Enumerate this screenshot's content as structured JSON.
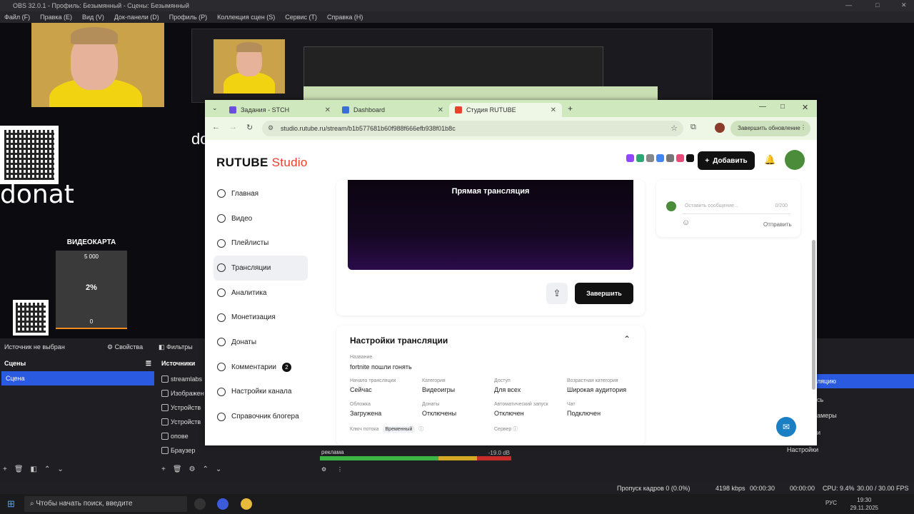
{
  "obs": {
    "window_title": "OBS 32.0.1 - Профиль: Безымянный - Сцены: Безымянный",
    "menu": [
      "Файл (F)",
      "Правка (E)",
      "Вид (V)",
      "Док-панели (D)",
      "Профиль (P)",
      "Коллекция сцен (S)",
      "Сервис (T)",
      "Справка (H)"
    ],
    "preview": {
      "donat_text": "donat",
      "do_fragment": "do",
      "gpu": {
        "title": "ВИДЕОКАРТА",
        "max": "5 000",
        "percent": "2%",
        "min": "0",
        "level_fraction": 0.02
      }
    },
    "source_status": "Источник не выбран",
    "properties_label": "Свойства",
    "filters_label": "Фильтры",
    "scenes_title": "Сцены",
    "scene_item": "Сцена",
    "sources_title": "Источники",
    "sources": [
      "streamlabs",
      "Изображен",
      "Устройств",
      "Устройств",
      "опове",
      "Браузер"
    ],
    "audio": {
      "name": "реклама",
      "db": "-19.0 dB"
    },
    "right_dock": [
      "ляцию",
      "сь",
      "амеры",
      "и",
      "Настройки"
    ],
    "status": {
      "dropped": "Пропуск кадров 0 (0.0%)",
      "bitrate": "4198 kbps",
      "live_time": "00:00:30",
      "rec_time": "00:00:00",
      "cpu": "CPU: 9.4%",
      "fps": "30.00 / 30.00 FPS"
    },
    "taskbar": {
      "search_placeholder": "Чтобы начать поиск, введите",
      "lang": "РУС",
      "time": "19:30",
      "date": "29.11.2025"
    }
  },
  "browser": {
    "tabs": [
      {
        "label": "Задания - STCH",
        "color": "#6b4fd8"
      },
      {
        "label": "Dashboard",
        "color": "#3a6fd8"
      },
      {
        "label": "Студия RUTUBE",
        "color": "#e8422f"
      }
    ],
    "url": "studio.rutube.ru/stream/b1b577681b60f988f666efb938f01b8c",
    "update_button": "Завершить обновление"
  },
  "rutube": {
    "logo_main": "RUTUBE",
    "logo_sub": "Studio",
    "add_button": "Добавить",
    "nav": [
      {
        "label": "Главная"
      },
      {
        "label": "Видео"
      },
      {
        "label": "Плейлисты"
      },
      {
        "label": "Трансляции"
      },
      {
        "label": "Аналитика"
      },
      {
        "label": "Монетизация"
      },
      {
        "label": "Донаты"
      },
      {
        "label": "Комментарии"
      },
      {
        "label": "Настройки канала"
      },
      {
        "label": "Справочник блогера"
      }
    ],
    "comments_badge": "2",
    "player_label": "Прямая трансляция",
    "finish_button": "Завершить",
    "chat": {
      "placeholder": "Оставить сообщение...",
      "counter": "0/200",
      "send": "Отправить"
    },
    "settings": {
      "title": "Настройки трансляции",
      "name_label": "Название",
      "name_value": "fortnite пошли гонять",
      "fields": [
        {
          "label": "Начало трансляции",
          "value": "Сейчас"
        },
        {
          "label": "Категория",
          "value": "Видеоигры"
        },
        {
          "label": "Доступ",
          "value": "Для всех"
        },
        {
          "label": "Возрастная категория",
          "value": "Широкая аудитория"
        },
        {
          "label": "Обложка",
          "value": "Загружена"
        },
        {
          "label": "Донаты",
          "value": "Отключены"
        },
        {
          "label": "Автоматический запуск",
          "value": "Отключен"
        },
        {
          "label": "Чат",
          "value": "Подключен"
        }
      ],
      "key_label": "Ключ потока",
      "key_tag": "Временный",
      "server_label": "Сервер"
    }
  }
}
